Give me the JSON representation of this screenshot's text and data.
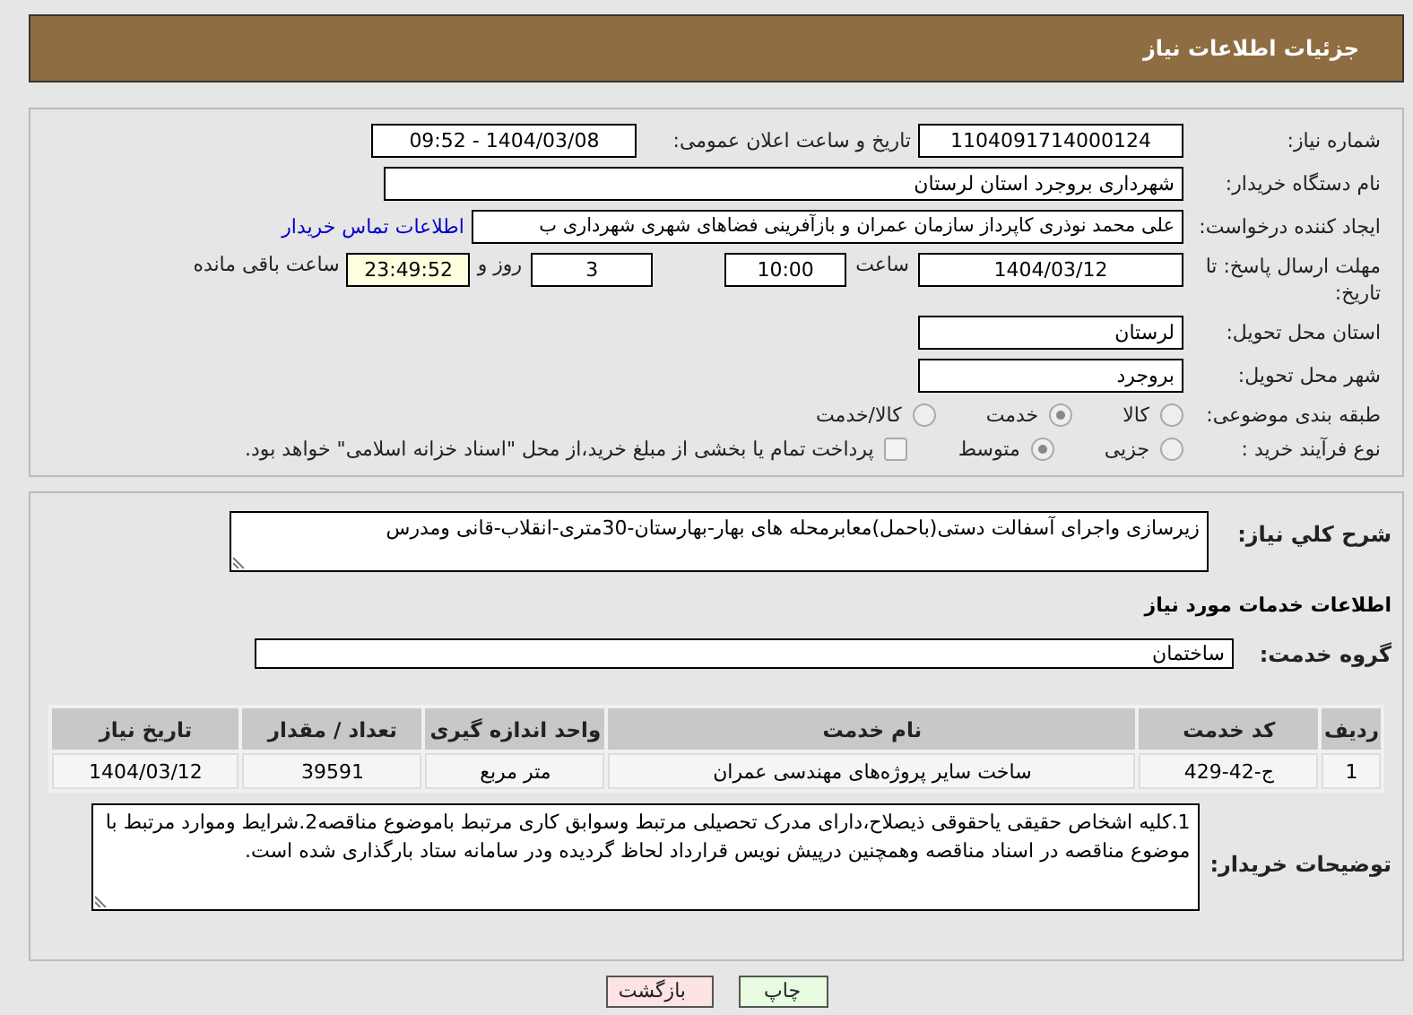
{
  "header": {
    "title": "جزئیات اطلاعات نیاز"
  },
  "details": {
    "need_number": {
      "label": "شماره نیاز:",
      "value": "1104091714000124"
    },
    "announce": {
      "label": "تاریخ و ساعت اعلان عمومی:",
      "value": "1404/03/08 - 09:52"
    },
    "buyer": {
      "label": "نام دستگاه خریدار:",
      "value": "شهرداری بروجرد استان لرستان"
    },
    "requester": {
      "label": "ایجاد کننده درخواست:",
      "value": "علی محمد نوذری کاپرداز سازمان عمران و بازآفرینی فضاهای شهری شهرداری ب",
      "link": "اطلاعات تماس خریدار"
    },
    "deadline": {
      "label": "مهلت ارسال پاسخ: تا تاریخ:",
      "date": "1404/03/12",
      "time_label": "ساعت",
      "time": "10:00",
      "days": "3",
      "days_label": "روز و",
      "remaining": "23:49:52",
      "remaining_label": "ساعت باقی مانده"
    },
    "province": {
      "label": "استان محل تحویل:",
      "value": "لرستان"
    },
    "city": {
      "label": "شهر محل تحویل:",
      "value": "بروجرد"
    },
    "category": {
      "label": "طبقه بندی موضوعی:",
      "options": [
        {
          "label": "کالا",
          "selected": false
        },
        {
          "label": "خدمت",
          "selected": true
        },
        {
          "label": "کالا/خدمت",
          "selected": false
        }
      ]
    },
    "process": {
      "label": "نوع فرآیند خرید :",
      "options": [
        {
          "label": "جزیی",
          "selected": false
        },
        {
          "label": "متوسط",
          "selected": true
        }
      ],
      "payment": {
        "label": "پرداخت تمام یا بخشی از مبلغ خرید،از محل \"اسناد خزانه اسلامی\" خواهد بود.",
        "checked": false
      }
    }
  },
  "services": {
    "description": {
      "label": "شرح کلي نياز:",
      "value": "زیرسازی واجرای آسفالت دستی(باحمل)معابرمحله های بهار-بهارستان-30متری-انقلاب-قانی ومدرس"
    },
    "section_title": "اطلاعات خدمات مورد نياز",
    "group": {
      "label": "گروه خدمت:",
      "value": "ساختمان"
    },
    "table": {
      "columns": [
        "رديف",
        "کد خدمت",
        "نام خدمت",
        "واحد اندازه گیری",
        "تعداد / مقدار",
        "تاریخ نیاز"
      ],
      "rows": [
        [
          "1",
          "ج-42-429",
          "ساخت سایر پروژه‌های مهندسی عمران",
          "متر مربع",
          "39591",
          "1404/03/12"
        ]
      ]
    },
    "notes": {
      "label": "توضیحات خریدار:",
      "value": "1.کلیه اشخاص حقیقی یاحقوقی ذیصلاح،دارای مدرک تحصیلی مرتبط وسوابق کاری مرتبط باموضوع مناقصه2.شرایط وموارد مرتبط با موضوع مناقصه در اسناد مناقصه وهمچنین درپیش نویس قرارداد لحاظ گردیده ودر سامانه ستاد بارگذاری شده است."
    }
  },
  "actions": [
    {
      "label": "چاپ",
      "kind": "print"
    },
    {
      "label": "بازگشت",
      "kind": "back"
    }
  ]
}
